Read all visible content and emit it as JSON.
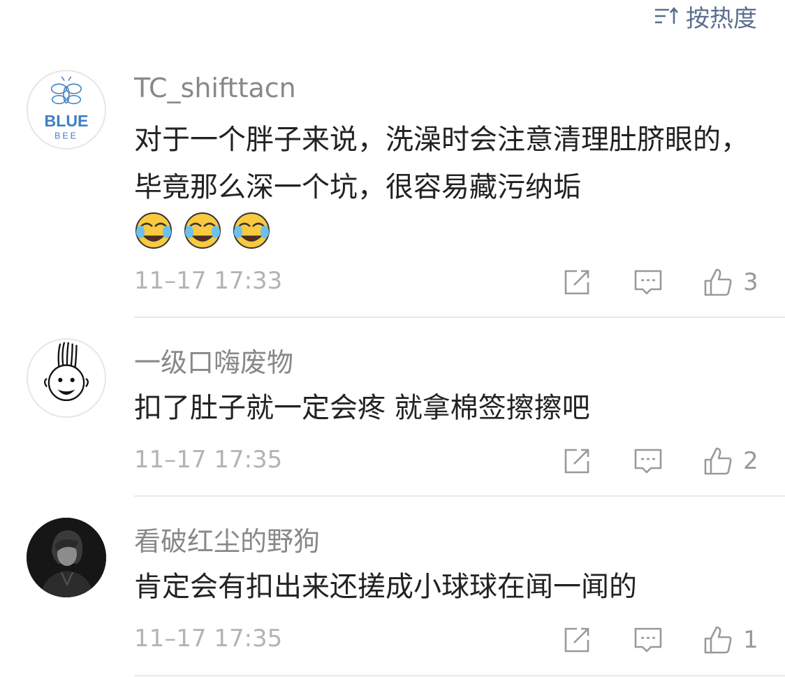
{
  "sort": {
    "label": "按热度",
    "icon": "sort-icon"
  },
  "comments": [
    {
      "username": "TC_shifttacn",
      "avatar": "avatar-blue-bee",
      "avatar_text": "BLUE BEE",
      "content": "对于一个胖子来说，洗澡时会注意清理肚脐眼的，毕竟那么深一个坑，很容易藏污纳垢",
      "emojis": [
        "laugh-cry-emoji",
        "laugh-cry-emoji",
        "laugh-cry-emoji"
      ],
      "timestamp": "11–17 17:33",
      "likes": "3"
    },
    {
      "username": "一级口嗨废物",
      "avatar": "avatar-cartoon-face",
      "content": "扣了肚子就一定会疼 就拿棉签擦擦吧",
      "timestamp": "11–17 17:35",
      "likes": "2"
    },
    {
      "username": "看破红尘的野狗",
      "avatar": "avatar-dark-portrait",
      "content": "肯定会有扣出来还搓成小球球在闻一闻的",
      "timestamp": "11–17 17:35",
      "likes": "1"
    }
  ],
  "colors": {
    "accent": "#5a6f8f",
    "username": "#888888",
    "meta": "#b3b3b3",
    "icon": "#999999",
    "divider": "#e9e9e9"
  }
}
